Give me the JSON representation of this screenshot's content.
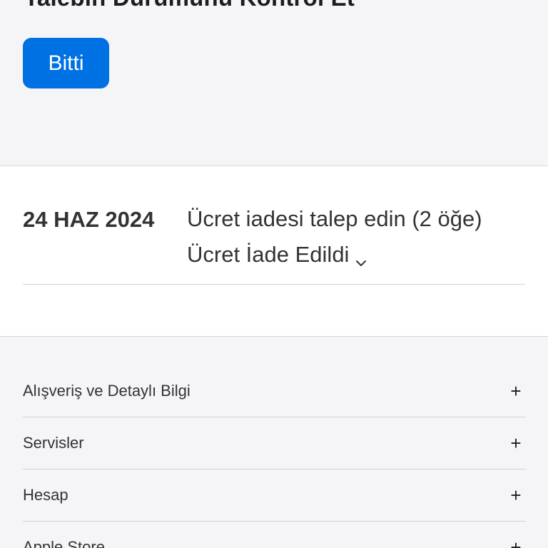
{
  "header": {
    "title": "Talebin Durumunu Kontrol Et",
    "done_label": "Bitti",
    "done_color": "#0071e3"
  },
  "request": {
    "date": "24 HAZ 2024",
    "description": "Ücret iadesi talep edin (2 öğe)",
    "status": "Ücret İade Edildi"
  },
  "footer": {
    "items": [
      {
        "label": "Alışveriş ve Detaylı Bilgi",
        "icon": "+"
      },
      {
        "label": "Servisler",
        "icon": "+"
      },
      {
        "label": "Hesap",
        "icon": "+"
      },
      {
        "label": "Apple Store",
        "icon": "+"
      }
    ]
  }
}
